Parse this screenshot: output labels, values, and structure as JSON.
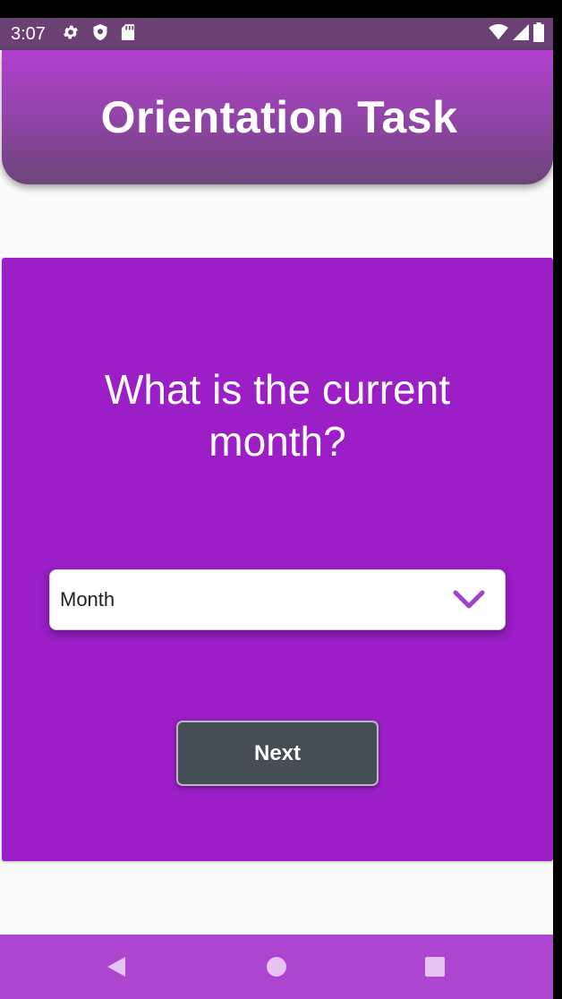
{
  "status_bar": {
    "time": "3:07",
    "icons_left": [
      "gear-icon",
      "shield-icon",
      "sd-card-icon"
    ],
    "icons_right": [
      "wifi-icon",
      "signal-icon",
      "battery-icon"
    ]
  },
  "header": {
    "title": "Orientation Task"
  },
  "question": {
    "text": "What is the current month?"
  },
  "month_dropdown": {
    "selected": "Month"
  },
  "next_button": {
    "label": "Next"
  },
  "nav_bar": {
    "buttons": [
      "back-icon",
      "home-icon",
      "recents-icon"
    ]
  },
  "colors": {
    "status_bar": "#6b4073",
    "card": "#9b1ec7",
    "button": "#444e54",
    "accent": "#ac45cf",
    "background": "#fafafa"
  }
}
